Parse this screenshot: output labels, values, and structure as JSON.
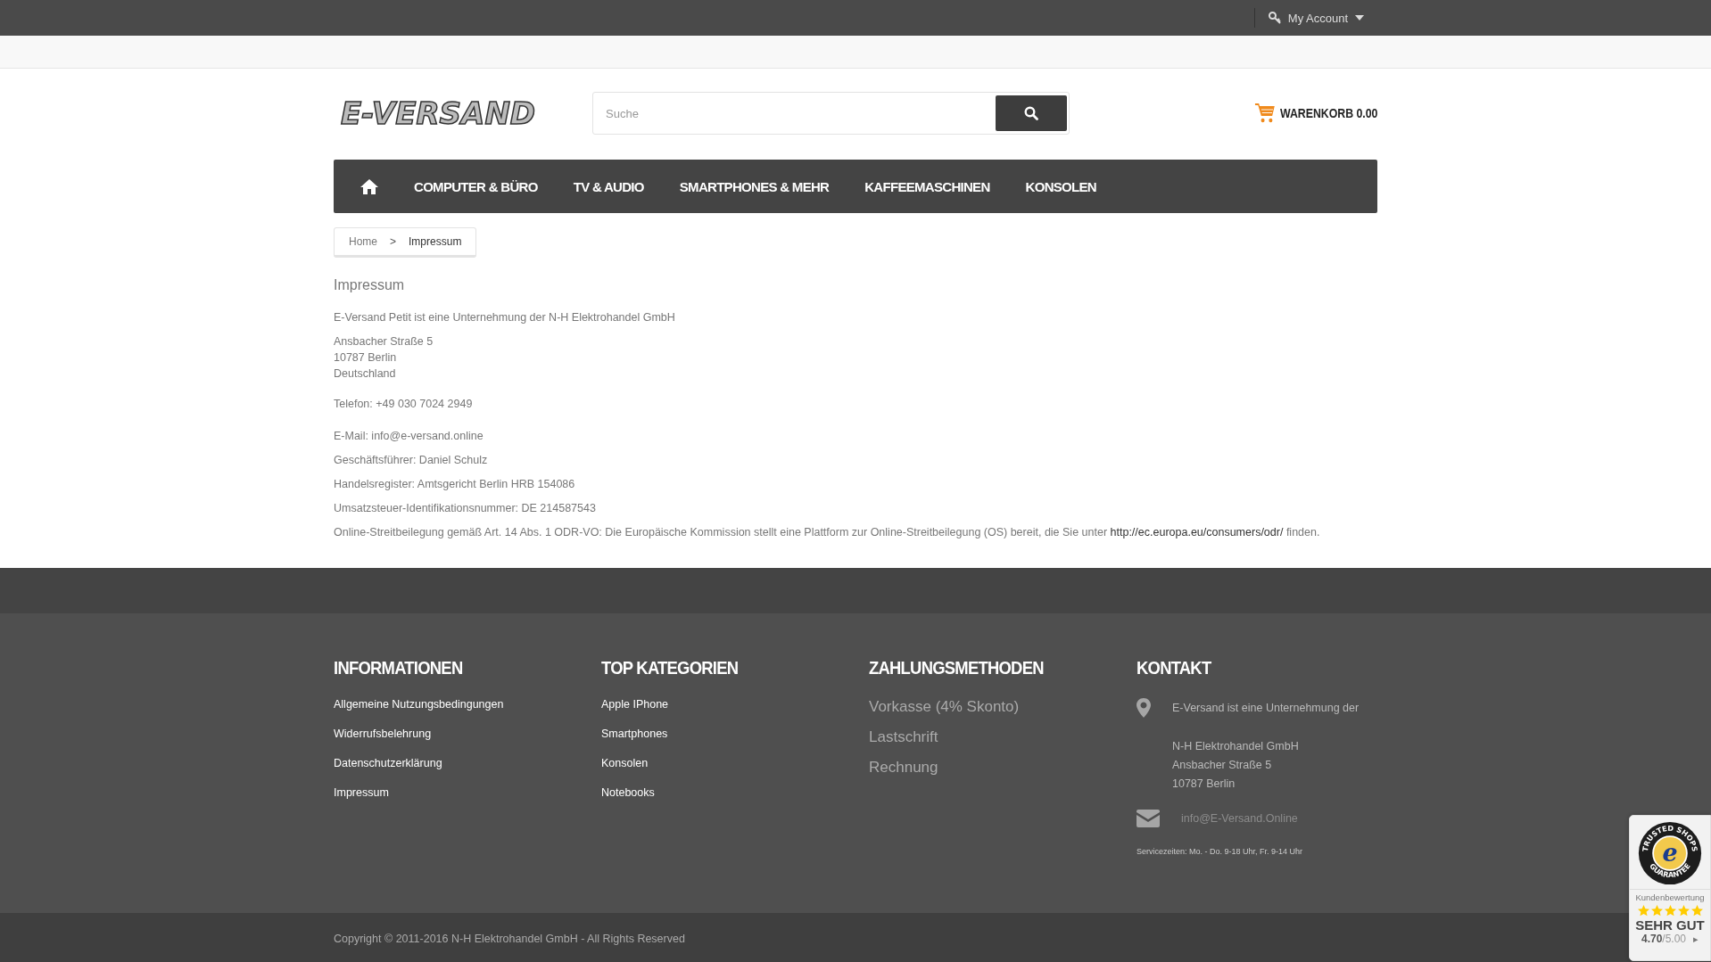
{
  "top_bar": {
    "account": "My Account"
  },
  "header": {
    "logo": "E-VERSAND",
    "search": {
      "placeholder": "Suche"
    },
    "cart": {
      "label": "WARENKORB",
      "amount": "0.00"
    }
  },
  "nav": {
    "items": [
      {
        "kind": "home"
      },
      {
        "kind": "text",
        "label": "COMPUTER & BÜRO"
      },
      {
        "kind": "text",
        "label": "TV & AUDIO"
      },
      {
        "kind": "text",
        "label": "SMARTPHONES & MEHR"
      },
      {
        "kind": "text",
        "label": "KAFFEEMASCHINEN"
      },
      {
        "kind": "text",
        "label": "KONSOLEN"
      }
    ]
  },
  "breadcrumb": [
    {
      "label": "Home",
      "current": false
    },
    {
      "label": "Impressum",
      "current": true
    }
  ],
  "breadcrumb_separator": ">",
  "page": {
    "title": "Impressum",
    "paragraphs": [
      {
        "lines": [
          "E-Versand Petit ist eine Unternehmung der N-H Elektrohandel GmbH"
        ]
      },
      {
        "lines": [
          "Ansbacher Straße 5",
          "10787 Berlin",
          "Deutschland"
        ]
      },
      {
        "lines": [
          "Telefon: +49 030 7024 2949"
        ]
      },
      {
        "lines": [
          "E-Mail: info@e-versand.online"
        ]
      },
      {
        "lines": [
          "Geschäftsführer: Daniel Schulz"
        ]
      },
      {
        "lines": [
          "Handelsregister: Amtsgericht Berlin HRB 154086"
        ]
      },
      {
        "lines": [
          "Umsatzsteuer-Identifikationsnummer: DE 214587543"
        ]
      }
    ],
    "odr": {
      "before": "Online-Streitbeilegung gemäß Art. 14 Abs. 1 ODR-VO: Die Europäische Kommission stellt eine Plattform zur Online-Streitbeilegung (OS) bereit, die Sie unter",
      "link": "http://ec.europa.eu/consumers/odr/",
      "after": "finden."
    }
  },
  "footer": {
    "columns": [
      {
        "kind": "links",
        "title": "INFORMATIONEN",
        "items": [
          "Allgemeine Nutzungsbedingungen",
          "Widerrufsbelehrung",
          "Datenschutzerklärung",
          "Impressum"
        ]
      },
      {
        "kind": "links",
        "title": "TOP KATEGORIEN",
        "items": [
          "Apple IPhone",
          "Smartphones",
          "Konsolen",
          "Notebooks"
        ]
      },
      {
        "kind": "payments",
        "title": "ZAHLUNGSMETHODEN",
        "items": [
          "Vorkasse (4% Skonto)",
          "Lastschrift",
          "Rechnung"
        ]
      },
      {
        "kind": "contact",
        "title": "KONTAKT",
        "intro": "E-Versand ist eine Unternehmung der",
        "address": [
          "N-H Elektrohandel GmbH",
          "Ansbacher Straße 5",
          "10787 Berlin"
        ],
        "email": "info@E-Versand.Online",
        "hours": "Servicezeiten: Mo. - Do. 9-18 Uhr, Fr. 9-14 Uhr"
      }
    ],
    "copyright": "Copyright © 2011-2016 N-H Elektrohandel GmbH - All Rights Reserved"
  },
  "trust_badge": {
    "seal_top": "TRUSTED SHOPS",
    "seal_bottom": "GUARANTEE",
    "seal_letter": "e",
    "label": "Kundenbewertung",
    "stars": 5,
    "verdict": "SEHR GUT",
    "score": "**4.70**/5.00",
    "more": "▸"
  }
}
